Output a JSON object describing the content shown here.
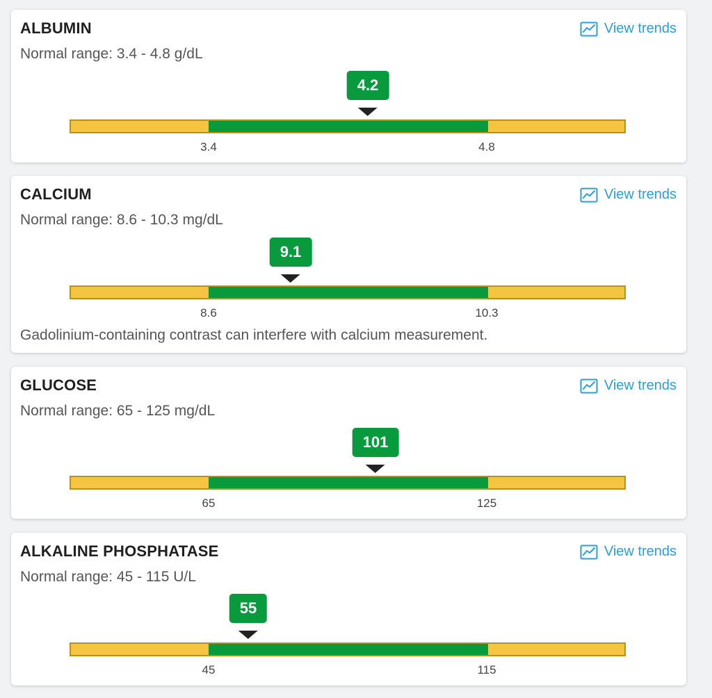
{
  "view_trends_label": "View trends",
  "colors": {
    "normal_range": "#0a9a3e",
    "out_of_range": "#f5c542",
    "link": "#2a9fd6",
    "marker_arrow": "#222222"
  },
  "icons": {
    "trends": "line-chart-icon"
  },
  "cards": [
    {
      "title": "ALBUMIN",
      "range_text": "Normal range: 3.4 - 4.8 g/dL",
      "value": "4.2",
      "low_label": "3.4",
      "high_label": "4.8",
      "note": ""
    },
    {
      "title": "CALCIUM",
      "range_text": "Normal range: 8.6 - 10.3 mg/dL",
      "value": "9.1",
      "low_label": "8.6",
      "high_label": "10.3",
      "note": "Gadolinium-containing contrast can interfere with calcium measurement."
    },
    {
      "title": "GLUCOSE",
      "range_text": "Normal range: 65 - 125 mg/dL",
      "value": "101",
      "low_label": "65",
      "high_label": "125",
      "note": ""
    },
    {
      "title": "ALKALINE PHOSPHATASE",
      "range_text": "Normal range: 45 - 115 U/L",
      "value": "55",
      "low_label": "45",
      "high_label": "115",
      "note": ""
    }
  ]
}
